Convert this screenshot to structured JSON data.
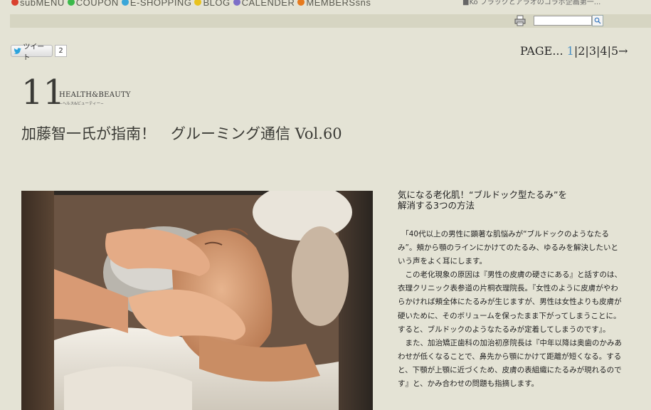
{
  "nav": {
    "items": [
      {
        "label": "subMENU",
        "color": "#d9402e"
      },
      {
        "label": "COUPON",
        "color": "#3bb94a"
      },
      {
        "label": "E-SHOPPING",
        "color": "#3aa6d8"
      },
      {
        "label": "BLOG",
        "color": "#e8c21e"
      },
      {
        "label": "CALENDER",
        "color": "#7d6fc8"
      },
      {
        "label": "MEMBERSsns",
        "color": "#e67a1e"
      }
    ],
    "news_snippet": "■Ko フラックとアラオのコラボ企画第一..."
  },
  "search": {
    "placeholder": ""
  },
  "tweet": {
    "label": "ツイート",
    "count": "2"
  },
  "pagination": {
    "prefix": "PAGE... ",
    "current": "1",
    "sep": "|",
    "pages": [
      "2",
      "3",
      "4",
      "5"
    ],
    "next": "→"
  },
  "article": {
    "issue_number": "11",
    "category_en": "HEALTH&BEAUTY",
    "category_jp": "−ヘルス&ビューティー−",
    "title": "加藤智一氏が指南！　グルーミング通信 Vol.60",
    "sub_heading_line1": "気になる老化肌！“ブルドック型たるみ”を",
    "sub_heading_line2": "解消する3つの方法",
    "paragraphs": [
      "「40代以上の男性に顕著な肌悩みが“ブルドックのようなたるみ”。頬から顎のラインにかけてのたるみ、ゆるみを解決したいという声をよく耳にします。",
      "この老化現象の原因は『男性の皮膚の硬さにある』と話すのは、衣理クリニック表参道の片桐衣理院長。『女性のように皮膚がやわらかければ頬全体にたるみが生じますが、男性は女性よりも皮膚が硬いために、そのボリュームを保ったまま下がってしまうことに。すると、ブルドックのようなたるみが定着してしまうのです』。",
      "また、加治矯正歯科の加治初彦院長は『中年以降は奥歯のかみあわせが低くなることで、鼻先から顎にかけて距離が短くなる。すると、下顎が上顎に近づくため、皮膚の表組織にたるみが現れるのです』と、かみ合わせの問題も指摘します。"
    ]
  },
  "colors": {
    "background": "#e4e3d5",
    "toolbar": "#d6d5c2",
    "page_current": "#4c92c4"
  }
}
